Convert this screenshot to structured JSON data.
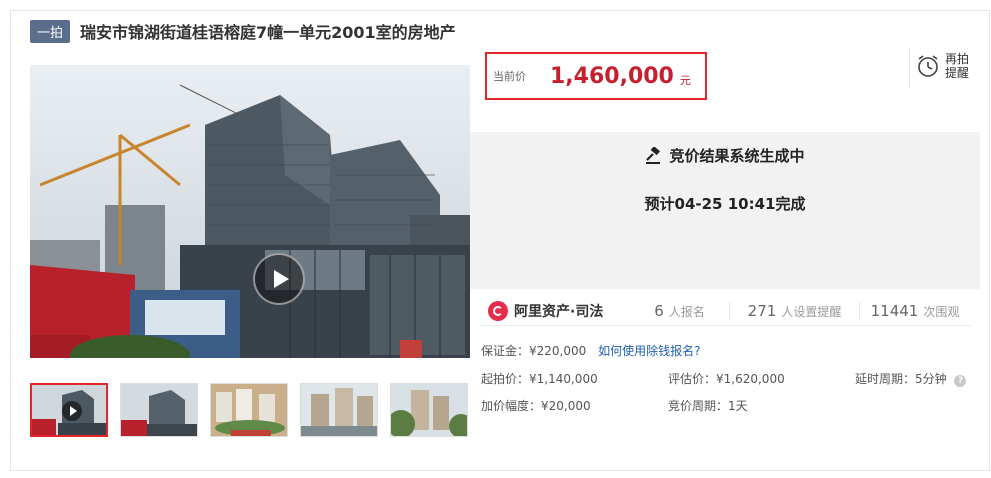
{
  "header": {
    "tag": "一拍",
    "title": "瑞安市锦湖街道桂语榕庭7幢一单元2001室的房地产"
  },
  "price": {
    "label": "当前价",
    "value": "1,460,000",
    "unit": "元"
  },
  "remind": {
    "line1": "再拍",
    "line2": "提醒"
  },
  "status": {
    "title": "竞价结果系统生成中",
    "eta": "预计04-25 10:41完成"
  },
  "platform": {
    "name": "阿里资产·司法"
  },
  "stats": [
    {
      "num": "6",
      "label": "人报名"
    },
    {
      "num": "271",
      "label": "人设置提醒"
    },
    {
      "num": "11441",
      "label": "次围观"
    }
  ],
  "details": {
    "deposit": "保证金：¥220,000",
    "deposit_link": "如何使用除钱报名?",
    "start_price": "起拍价：¥1,140,000",
    "appraisal": "评估价：¥1,620,000",
    "delay": "延时周期：5分钟",
    "increment": "加价幅度：¥20,000",
    "auction_period": "竞价周期：1天"
  },
  "colors": {
    "accent_red": "#e5252c",
    "price_red": "#c6202e",
    "tag_bg": "#5a6e8c",
    "link_blue": "#1f5fb4"
  },
  "icons": {
    "play": "play-icon",
    "alarm": "alarm-clock-icon",
    "gavel": "gavel-icon",
    "help": "help-circle-icon",
    "logo": "alibaba-asset-logo-icon"
  }
}
